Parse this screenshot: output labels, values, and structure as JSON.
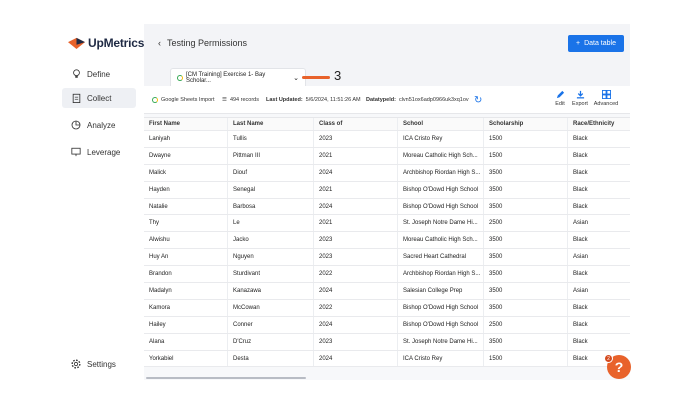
{
  "brand": {
    "name": "UpMetrics"
  },
  "sidebar": {
    "items": [
      {
        "label": "Define",
        "icon": "lightbulb-icon"
      },
      {
        "label": "Collect",
        "icon": "clipboard-icon"
      },
      {
        "label": "Analyze",
        "icon": "pie-chart-icon"
      },
      {
        "label": "Leverage",
        "icon": "presentation-icon"
      }
    ],
    "settings_label": "Settings"
  },
  "header": {
    "title": "Testing Permissions",
    "primary_button": "Data table"
  },
  "dataset_tab": {
    "label": "[CM Training] Exercise 1- Bay Scholar..."
  },
  "callout": {
    "number": "3",
    "color": "#e8622b"
  },
  "toolbar": {
    "source": "Google Sheets Import",
    "records": "494 records",
    "last_updated_label": "Last Updated:",
    "last_updated_value": "5/6/2024, 11:51:26 AM",
    "datatype_label": "Datatypeld:",
    "datatype_value": "clvn51ox6adp0966uk3xq1ov",
    "edit": "Edit",
    "export": "Export",
    "advanced": "Advanced"
  },
  "table": {
    "columns": [
      "First Name",
      "Last Name",
      "Class of",
      "School",
      "Scholarship",
      "Race/Ethnicity"
    ],
    "rows": [
      [
        "Laniyah",
        "Tullis",
        "2023",
        "ICA Cristo Rey",
        "1500",
        "Black"
      ],
      [
        "Dwayne",
        "Pittman III",
        "2021",
        "Moreau Catholic High Sch...",
        "1500",
        "Black"
      ],
      [
        "Malick",
        "Diouf",
        "2024",
        "Archbishop Riordan High S...",
        "3500",
        "Black"
      ],
      [
        "Hayden",
        "Senegal",
        "2021",
        "Bishop O'Dowd High School",
        "3500",
        "Black"
      ],
      [
        "Natalie",
        "Barbosa",
        "2024",
        "Bishop O'Dowd High School",
        "3500",
        "Black"
      ],
      [
        "Thy",
        "Le",
        "2021",
        "St. Joseph Notre Dame Hi...",
        "2500",
        "Asian"
      ],
      [
        "Alwishu",
        "Jacko",
        "2023",
        "Moreau Catholic High Sch...",
        "3500",
        "Black"
      ],
      [
        "Huy An",
        "Nguyen",
        "2023",
        "Sacred Heart Cathedral",
        "3500",
        "Asian"
      ],
      [
        "Brandon",
        "Sturdivant",
        "2022",
        "Archbishop Riordan High S...",
        "3500",
        "Black"
      ],
      [
        "Madalyn",
        "Kanazawa",
        "2024",
        "Salesian College Prep",
        "3500",
        "Asian"
      ],
      [
        "Kamora",
        "McCowan",
        "2022",
        "Bishop O'Dowd High School",
        "3500",
        "Black"
      ],
      [
        "Hailey",
        "Conner",
        "2024",
        "Bishop O'Dowd High School",
        "2500",
        "Black"
      ],
      [
        "Alana",
        "D'Cruz",
        "2023",
        "St. Joseph Notre Dame Hi...",
        "3500",
        "Black"
      ],
      [
        "Yorkabiel",
        "Desta",
        "2024",
        "ICA Cristo Rey",
        "1500",
        "Black"
      ]
    ]
  },
  "help": {
    "label": "?",
    "badge": "2"
  },
  "colors": {
    "primary": "#1a73e8",
    "accent": "#e8622b",
    "sheets_green": "#34a853"
  }
}
